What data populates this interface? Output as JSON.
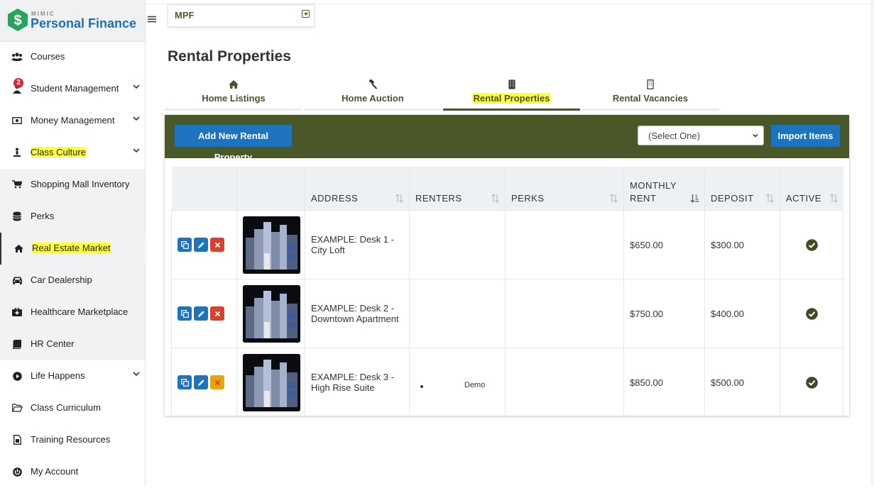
{
  "app": {
    "brand_small": "MIMIC",
    "brand": "Personal Finance"
  },
  "sidebar": {
    "items": [
      {
        "label": "Courses",
        "icon": "users-icon"
      },
      {
        "label": "Student Management",
        "icon": "user-icon",
        "badge": "2"
      },
      {
        "label": "Money Management",
        "icon": "money-icon"
      },
      {
        "label": "Class Culture",
        "icon": "person-icon"
      },
      {
        "label": "Shopping Mall Inventory",
        "icon": "cart-icon"
      },
      {
        "label": "Perks",
        "icon": "database-icon"
      },
      {
        "label": "Real Estate Market",
        "icon": "home-icon"
      },
      {
        "label": "Car Dealership",
        "icon": "car-icon"
      },
      {
        "label": "Healthcare Marketplace",
        "icon": "medkit-icon"
      },
      {
        "label": "HR Center",
        "icon": "book-icon"
      },
      {
        "label": "Life Happens",
        "icon": "play-circle-icon"
      },
      {
        "label": "Class Curriculum",
        "icon": "folder-icon"
      },
      {
        "label": "Training Resources",
        "icon": "file-icon"
      },
      {
        "label": "My Account",
        "icon": "power-icon"
      }
    ]
  },
  "topbar": {
    "selector": "MPF"
  },
  "page": {
    "title": "Rental Properties"
  },
  "tabs": [
    {
      "label": "Home Listings",
      "icon": "home-icon"
    },
    {
      "label": "Home Auction",
      "icon": "gavel-icon"
    },
    {
      "label": "Rental Properties",
      "icon": "building-icon",
      "active": true
    },
    {
      "label": "Rental Vacancies",
      "icon": "building-outline-icon"
    }
  ],
  "toolbar": {
    "add_label": "Add New Rental Property",
    "select_value": "(Select One)",
    "import_label": "Import Items"
  },
  "table": {
    "columns": [
      "",
      "",
      "ADDRESS",
      "RENTERS",
      "PERKS",
      "MONTHLY RENT",
      "DEPOSIT",
      "ACTIVE"
    ],
    "rows": [
      {
        "address": "EXAMPLE: Desk 1 - City Loft",
        "renters": "",
        "perks": "",
        "rent": "$650.00",
        "deposit": "$300.00",
        "active": true
      },
      {
        "address": "EXAMPLE: Desk 2 - Downtown Apartment",
        "renters": "",
        "perks": "",
        "rent": "$750.00",
        "deposit": "$400.00",
        "active": true
      },
      {
        "address": "EXAMPLE: Desk 3 - High Rise Suite",
        "renters": "Demo",
        "perks": "",
        "rent": "$850.00",
        "deposit": "$500.00",
        "active": true
      }
    ]
  },
  "colors": {
    "accent": "#4a5729",
    "primary": "#1e73be",
    "danger": "#d9412c",
    "highlight": "#ffff3c"
  }
}
